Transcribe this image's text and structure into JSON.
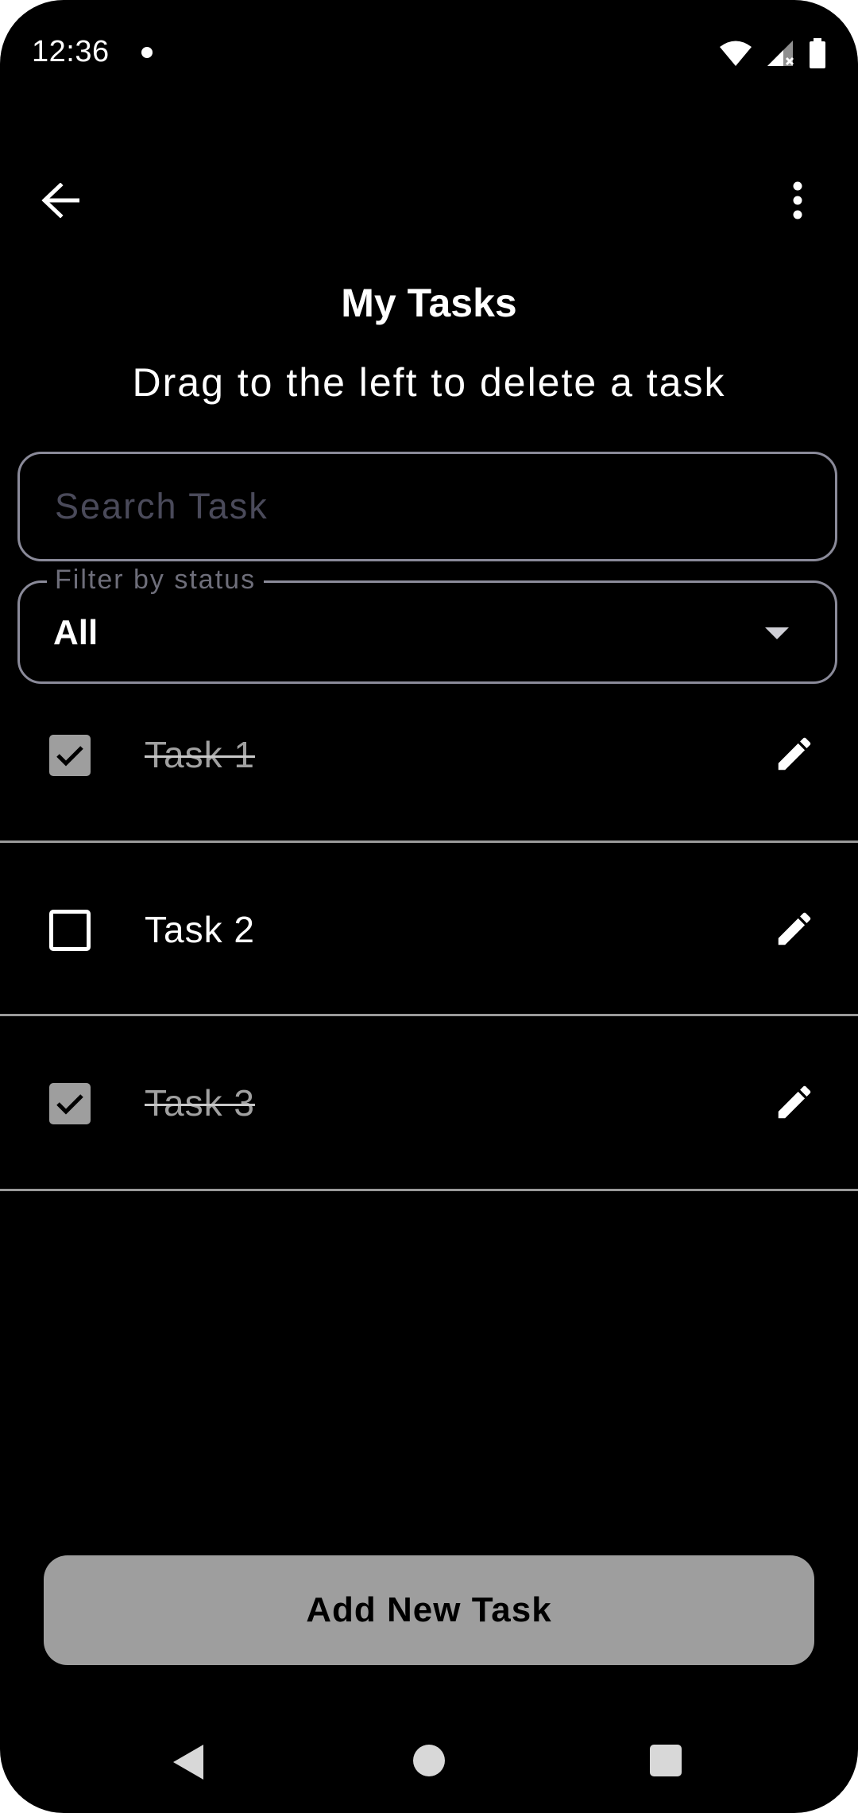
{
  "status_bar": {
    "time": "12:36",
    "icons": [
      "notification-dot-icon",
      "wifi-icon",
      "cellular-signal-icon",
      "battery-icon"
    ]
  },
  "app_bar": {
    "back_icon": "arrow-left-icon",
    "menu_icon": "more-vert-icon"
  },
  "header": {
    "title": "My Tasks",
    "subtitle": "Drag to the left to delete a task"
  },
  "search": {
    "placeholder": "Search Task",
    "value": ""
  },
  "filter": {
    "label": "Filter by status",
    "value": "All"
  },
  "tasks": [
    {
      "label": "Task 1",
      "completed": true
    },
    {
      "label": "Task 2",
      "completed": false
    },
    {
      "label": "Task 3",
      "completed": true
    }
  ],
  "actions": {
    "add_button_label": "Add New Task"
  },
  "colors": {
    "background": "#000000",
    "button": "#9e9e9e",
    "outline": "#8a8a99",
    "divider": "#9a9a9a"
  }
}
